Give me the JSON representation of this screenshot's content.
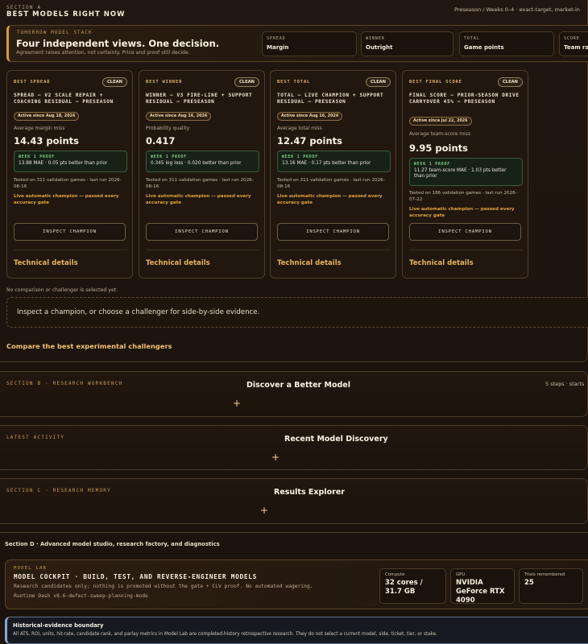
{
  "sectionA": {
    "label": "SECTION A",
    "title": "BEST MODELS RIGHT NOW",
    "meta": "Preseason / Weeks 0–4 · exact-target, market-in"
  },
  "stack": {
    "label": "TOMORROW MODEL STACK",
    "headline": "Four independent views. One decision.",
    "subline": "Agreement raises attention, not certainty. Price and proof still decide.",
    "chips": [
      {
        "key": "SPREAD",
        "value": "Margin"
      },
      {
        "key": "WINNER",
        "value": "Outright"
      },
      {
        "key": "TOTAL",
        "value": "Game points"
      },
      {
        "key": "SCORE",
        "value": "Team range"
      }
    ]
  },
  "cards": [
    {
      "kicker": "BEST SPREAD",
      "badge": "CLEAN",
      "name": "SPREAD — V2 SCALE REPAIR + COACHING RESIDUAL — PRESEASON",
      "since": "Active since Aug 18, 2026",
      "metric_label": "Average margin miss",
      "metric_value": "14.43 points",
      "proof_label": "WEEK 1 PROOF",
      "proof_value": "13.88 MAE · 0.05 pts better than prior",
      "tested": "Tested on 311 validation games · last run 2026-08-16",
      "live": "Live automatic champion — passed every accuracy gate",
      "inspect": "INSPECT CHAMPION",
      "tech": "Technical details"
    },
    {
      "kicker": "BEST WINNER",
      "badge": "CLEAN",
      "name": "WINNER — V3 FIRE-LINE + SUPPORT RESIDUAL — PRESEASON",
      "since": "Active since Aug 16, 2026",
      "metric_label": "Probability quality",
      "metric_value": "0.417",
      "proof_label": "WEEK 1 PROOF",
      "proof_value": "0.345 log loss · 0.020 better than prior",
      "tested": "Tested on 311 validation games · last run 2026-08-16",
      "live": "Live automatic champion — passed every accuracy gate",
      "inspect": "INSPECT CHAMPION",
      "tech": "Technical details"
    },
    {
      "kicker": "BEST TOTAL",
      "badge": "CLEAN",
      "name": "TOTAL — LIVE CHAMPION + SUPPORT RESIDUAL — PRESEASON",
      "since": "Active since Aug 16, 2026",
      "metric_label": "Average total miss",
      "metric_value": "12.47 points",
      "proof_label": "WEEK 1 PROOF",
      "proof_value": "13.16 MAE · 0.17 pts better than prior",
      "tested": "Tested on 311 validation games · last run 2026-08-16",
      "live": "Live automatic champion — passed every accuracy gate",
      "inspect": "INSPECT CHAMPION",
      "tech": "Technical details"
    },
    {
      "kicker": "BEST FINAL SCORE",
      "badge": "CLEAN",
      "name": "FINAL SCORE — PRIOR-SEASON DRIVE CARRYOVER 45% — PRESEASON",
      "since": "Active since Jul 22, 2026",
      "metric_label": "Average team-score miss",
      "metric_value": "9.95 points",
      "proof_label": "WEEK 1 PROOF",
      "proof_value": "11.27 team-score MAE · 1.03 pts better than prior",
      "tested": "Tested on 186 validation games · last run 2026-07-22",
      "live": "Live automatic champion — passed every accuracy gate",
      "inspect": "INSPECT CHAMPION",
      "tech": "Technical details"
    }
  ],
  "comparison": {
    "status": "No comparison or challenger is selected yet.",
    "prompt": "Inspect a champion, or choose a challenger for side-by-side evidence.",
    "compare_link": "Compare the best experimental challengers"
  },
  "sectionB": {
    "label": "SECTION B · RESEARCH WORKBENCH",
    "title": "Discover a Better Model",
    "meta": "5 steps · starts",
    "toggle": "+"
  },
  "activity": {
    "label": "LATEST ACTIVITY",
    "title": "Recent Model Discovery",
    "toggle": "+"
  },
  "sectionC": {
    "label": "SECTION C · RESEARCH MEMORY",
    "title": "Results Explorer",
    "toggle": "+"
  },
  "sectionD": {
    "title": "Section D · Advanced model studio, research factory, and diagnostics"
  },
  "modelLab": {
    "label": "MODEL LAB",
    "title": "MODEL COCKPIT · BUILD, TEST, AND REVERSE-ENGINEER MODELS",
    "subline": "Research candidates only; nothing is promoted without the gate + CLV proof. No automated wagering.",
    "runtime": "Runtime Dash v8.6-defect-sweep-planning-mode",
    "resources": [
      {
        "key": "Compute",
        "value": "32 cores / 31.7 GB"
      },
      {
        "key": "GPU",
        "value": "NVIDIA GeForce RTX 4090"
      },
      {
        "key": "Trials remembered",
        "value": "25"
      }
    ]
  },
  "historical": {
    "title": "Historical-evidence boundary",
    "body": "All ATS, ROI, units, hit-rate, candidate-rank, and parlay metrics in Model Lab are completed-history retrospective research. They do not select a current model, side, ticket, tier, or stake."
  }
}
